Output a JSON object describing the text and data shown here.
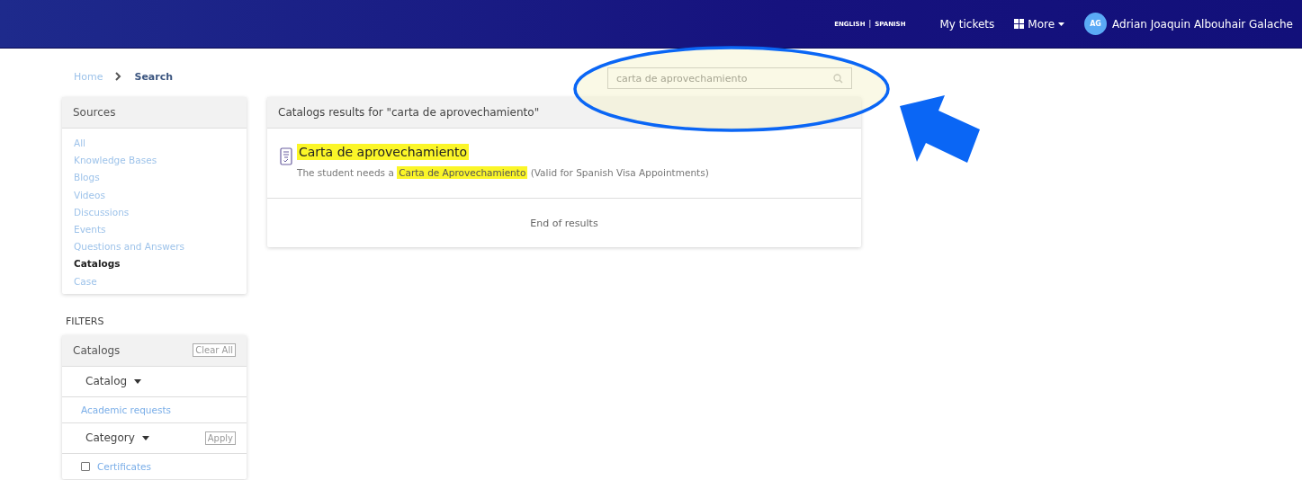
{
  "header": {
    "languages": [
      {
        "label": "ENGLISH"
      },
      {
        "label": "SPANISH"
      }
    ],
    "separator": "|",
    "nav": [
      {
        "label": "My tickets",
        "kind": "link"
      },
      {
        "label": "More",
        "kind": "menu"
      }
    ],
    "user": {
      "initials": "AG",
      "name": "Adrian Joaquin Albouhair Galache"
    }
  },
  "breadcrumb": [
    {
      "label": "Home",
      "selected": false
    },
    {
      "label": "Search",
      "selected": true
    }
  ],
  "search": {
    "value": "carta de aprovechamiento"
  },
  "sources": {
    "title": "Sources",
    "items": [
      {
        "label": "All",
        "selected": false
      },
      {
        "label": "Knowledge Bases",
        "selected": false
      },
      {
        "label": "Blogs",
        "selected": false
      },
      {
        "label": "Videos",
        "selected": false
      },
      {
        "label": "Discussions",
        "selected": false
      },
      {
        "label": "Events",
        "selected": false
      },
      {
        "label": "Questions and Answers",
        "selected": false
      },
      {
        "label": "Catalogs",
        "selected": true
      },
      {
        "label": "Case",
        "selected": false
      }
    ]
  },
  "filters": {
    "heading": "FILTERS",
    "title": "Catalogs",
    "clear": "Clear All",
    "groups": [
      {
        "label": "Catalog",
        "options": [
          {
            "label": "Academic requests",
            "kind": "link"
          }
        ]
      },
      {
        "label": "Category",
        "button": "Apply",
        "options": [
          {
            "label": "Certificates",
            "kind": "checkbox",
            "checked": false
          }
        ]
      }
    ]
  },
  "results": {
    "heading": "Catalogs results for \"carta de aprovechamiento\"",
    "items": [
      {
        "title": "Carta de aprovechamiento",
        "title_highlighted": true,
        "description": [
          {
            "text": "The student needs a ",
            "highlighted": false
          },
          {
            "text": "Carta de Aprovechamiento",
            "highlighted": true
          },
          {
            "text": " (Valid for Spanish Visa Appointments)",
            "highlighted": false
          }
        ]
      }
    ],
    "footer": "End of results"
  },
  "annotations": {
    "search_circled": true,
    "arrow": true
  }
}
